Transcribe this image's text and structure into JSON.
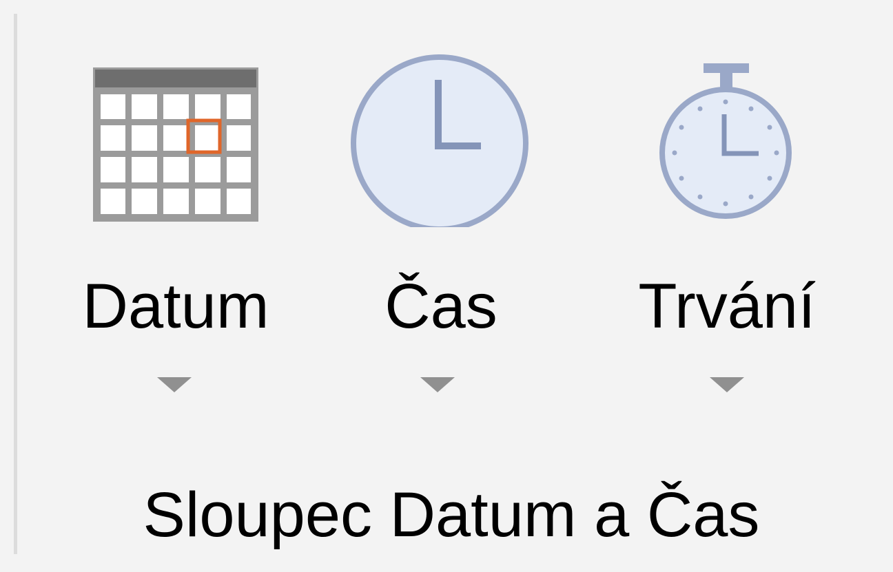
{
  "group": {
    "label": "Sloupec Datum a Čas",
    "buttons": [
      {
        "label": "Datum",
        "icon": "calendar-icon",
        "has_dropdown": true
      },
      {
        "label": "Čas",
        "icon": "clock-icon",
        "has_dropdown": true
      },
      {
        "label": "Trvání",
        "icon": "stopwatch-icon",
        "has_dropdown": true
      }
    ]
  },
  "colors": {
    "background": "#f3f3f3",
    "calendar_frame": "#6e6e6e",
    "calendar_highlight": "#e0662a",
    "clock_face": "#e4ebf7",
    "clock_stroke": "#9aa8c8",
    "dropdown_arrow": "#909090"
  }
}
